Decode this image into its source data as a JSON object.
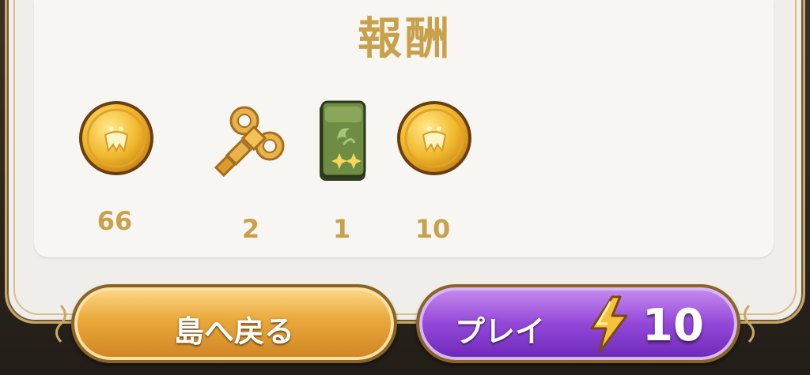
{
  "title": "報酬",
  "rewards": [
    {
      "name": "coin",
      "amount": "66"
    },
    {
      "name": "wind-up-key",
      "amount": "2"
    },
    {
      "name": "green-card-pack",
      "amount": "1"
    },
    {
      "name": "coin",
      "amount": "10"
    }
  ],
  "buttons": {
    "back_label": "島へ戻る",
    "play_label": "プレイ",
    "play_cost": "10"
  },
  "colors": {
    "gold_text": "#c9a14b",
    "back_button": "#e9a83b",
    "play_button": "#9348d8"
  }
}
